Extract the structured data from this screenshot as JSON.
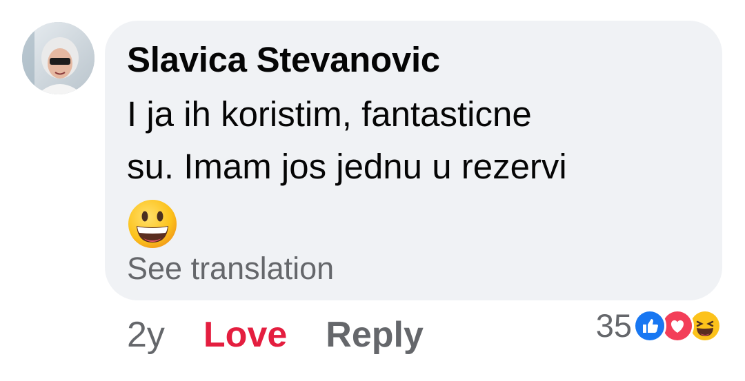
{
  "comment": {
    "author": "Slavica Stevanovic",
    "text_lines": [
      "I ja ih koristim, fantasticne",
      "su. Imam jos jednu u rezervi"
    ],
    "emoji": "grinning-face-icon",
    "see_translation": "See translation"
  },
  "actions": {
    "time": "2y",
    "love": "Love",
    "reply": "Reply"
  },
  "reactions": {
    "count": "35",
    "icons": [
      "like-reaction-icon",
      "love-reaction-icon",
      "haha-reaction-icon"
    ]
  },
  "colors": {
    "bubble": "#f0f2f5",
    "love": "#e41e3f",
    "secondary": "#65676b",
    "like": "#1877f2"
  }
}
